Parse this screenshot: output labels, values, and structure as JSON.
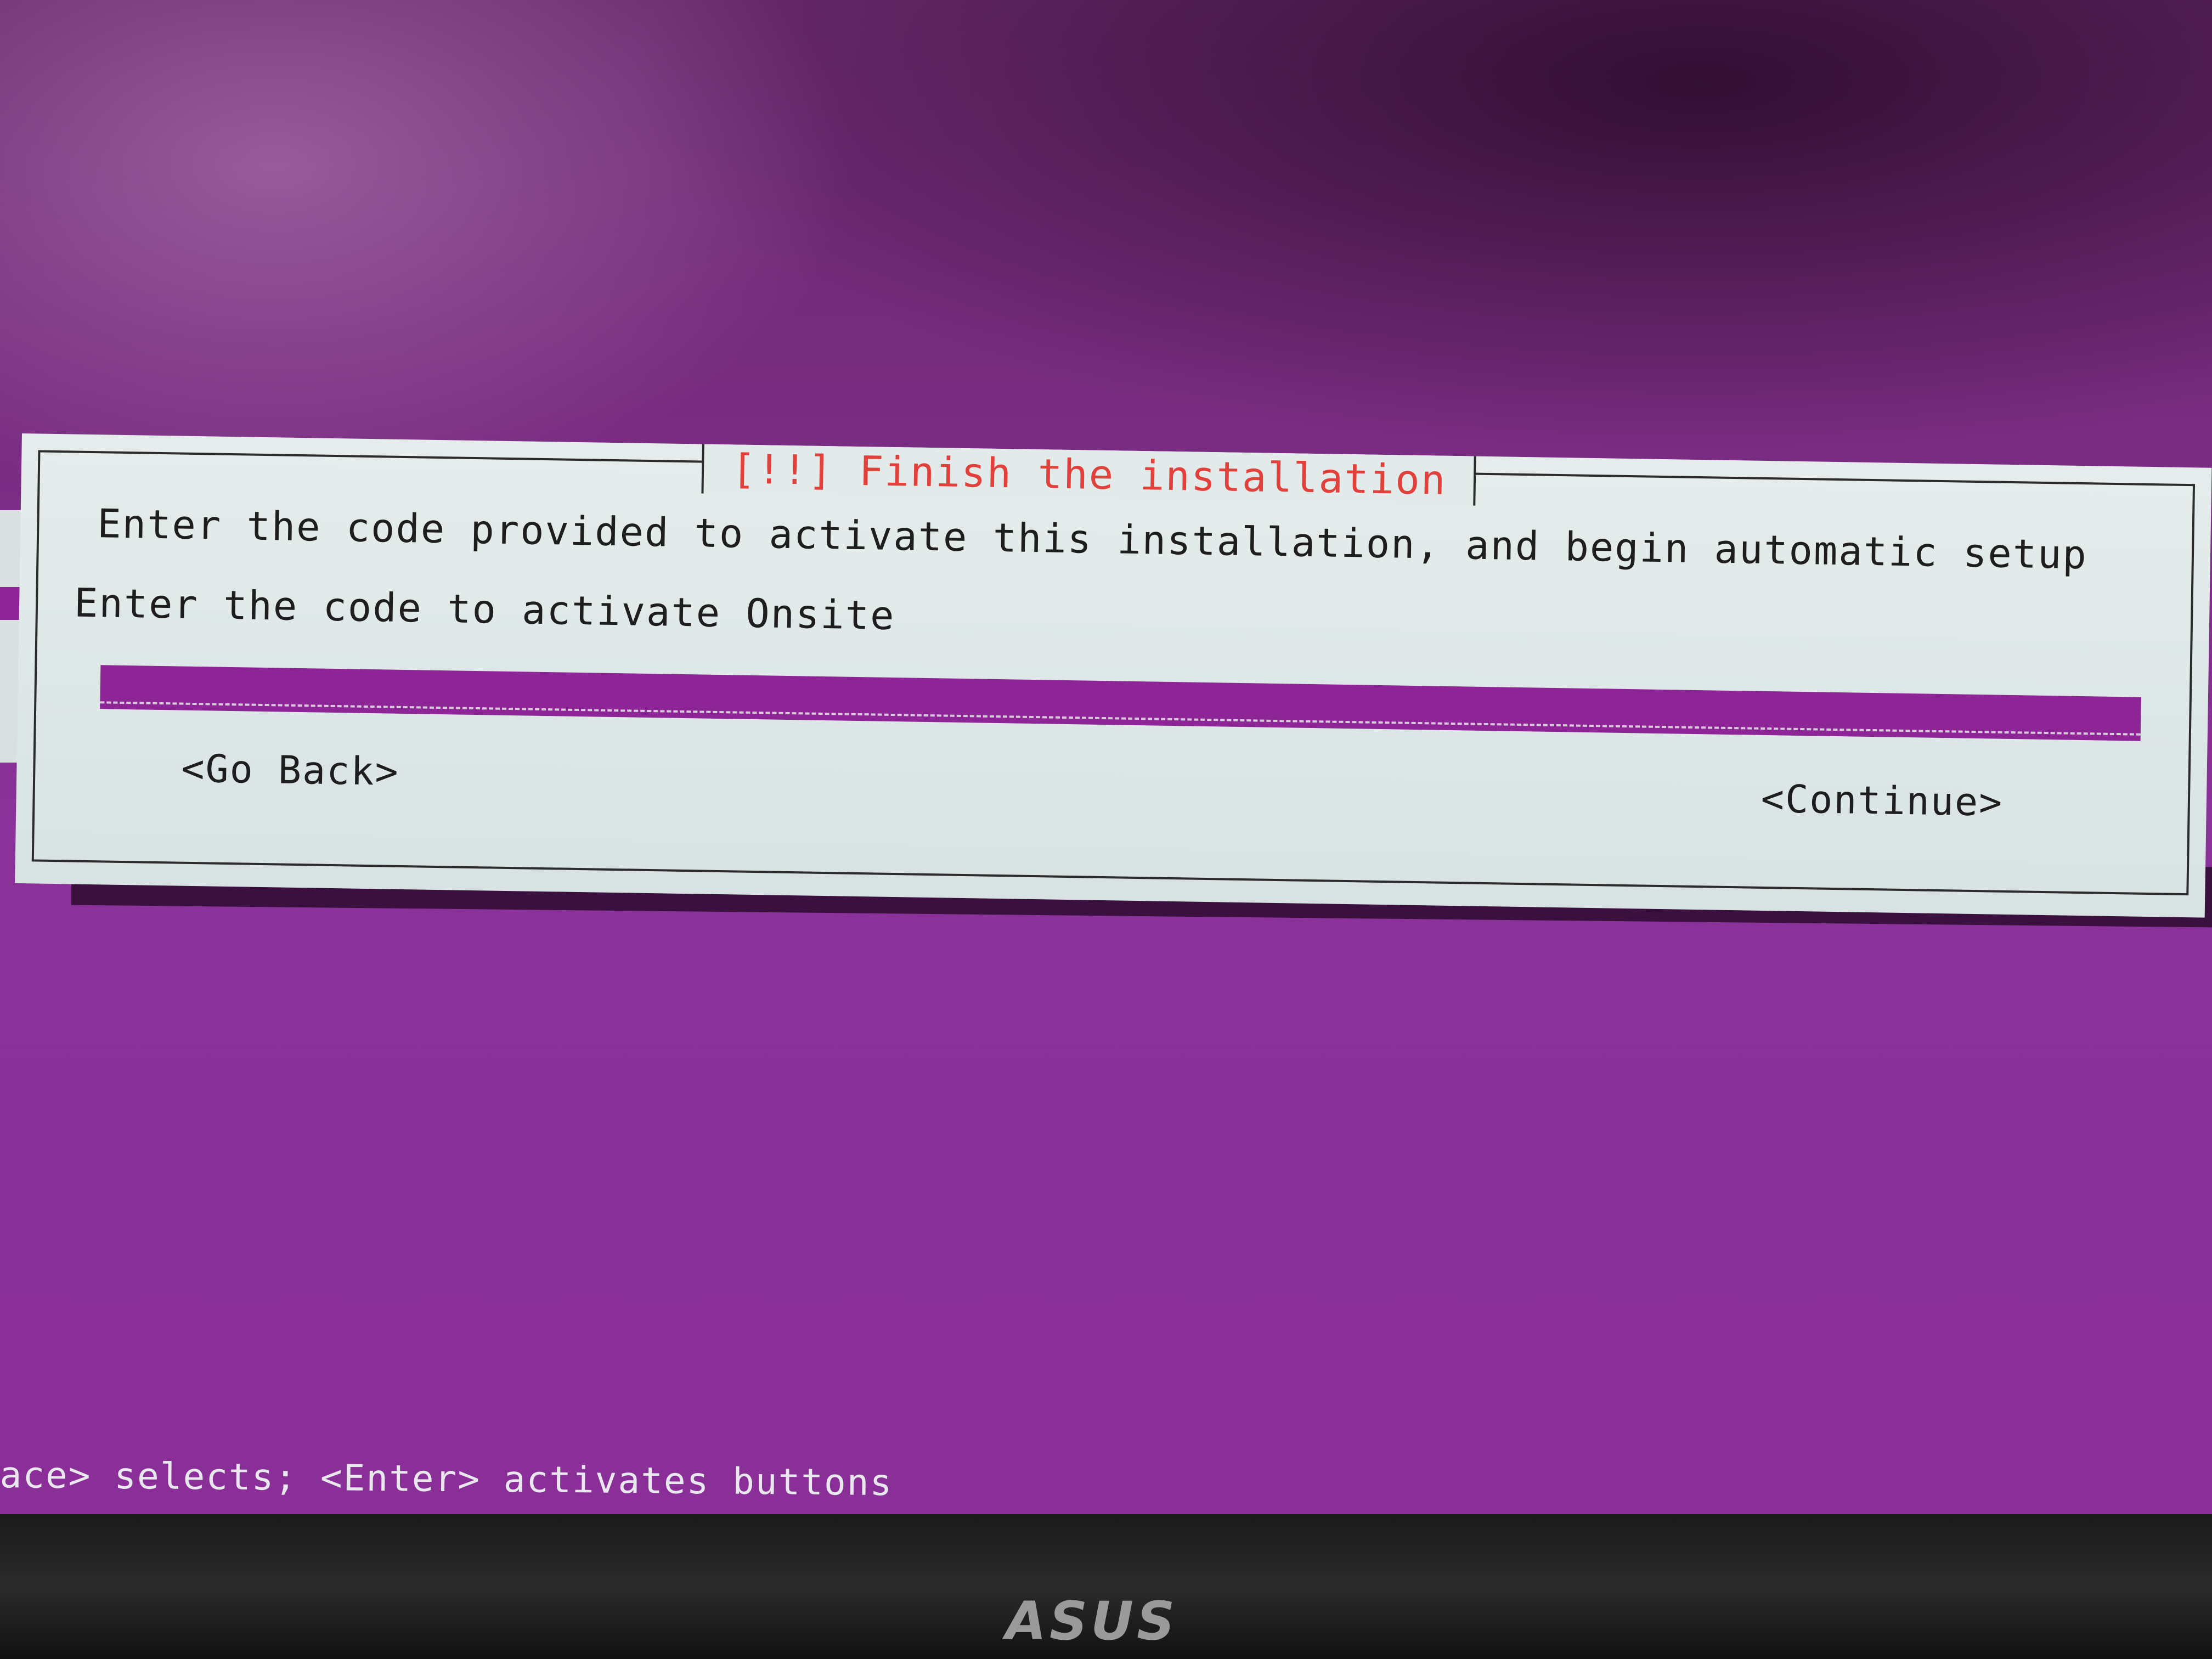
{
  "dialog": {
    "title": "[!!] Finish the installation",
    "description": "Enter the code provided to activate this installation, and begin automatic setup",
    "prompt": "Enter the code to activate Onsite",
    "code_input": {
      "value": ""
    },
    "buttons": {
      "go_back": "<Go Back>",
      "continue": "<Continue>"
    }
  },
  "status_bar": {
    "text": "ace> selects; <Enter> activates buttons"
  },
  "monitor": {
    "brand": "ASUS"
  },
  "colors": {
    "background": "#8a2e96",
    "dialog": "#e3eaea",
    "title": "#e2403a",
    "input_field": "#8e2596",
    "text": "#1e1e1e"
  }
}
